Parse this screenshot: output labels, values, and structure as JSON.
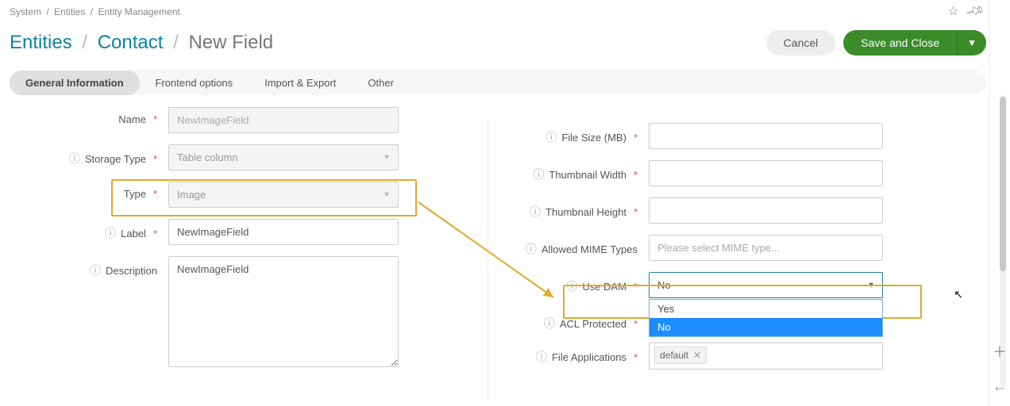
{
  "breadcrumbs": {
    "a": "System",
    "b": "Entities",
    "c": "Entity Management"
  },
  "title": {
    "a": "Entities",
    "b": "Contact",
    "c": "New Field"
  },
  "actions": {
    "cancel": "Cancel",
    "save": "Save and Close"
  },
  "tabs": {
    "general": "General Information",
    "frontend": "Frontend options",
    "import": "Import & Export",
    "other": "Other"
  },
  "left_form": {
    "name_label": "Name",
    "name_value": "NewImageField",
    "storage_label": "Storage Type",
    "storage_value": "Table column",
    "type_label": "Type",
    "type_value": "Image",
    "label_label": "Label",
    "label_value": "NewImageField",
    "desc_label": "Description",
    "desc_value": "NewImageField"
  },
  "right_form": {
    "filesize_label": "File Size (MB)",
    "filesize_value": "",
    "thumbw_label": "Thumbnail Width",
    "thumbw_value": "",
    "thumbh_label": "Thumbnail Height",
    "thumbh_value": "",
    "mime_label": "Allowed MIME Types",
    "mime_placeholder": "Please select MIME type...",
    "usedam_label": "Use DAM",
    "usedam_value": "No",
    "usedam_opts": {
      "yes": "Yes",
      "no": "No"
    },
    "acl_label": "ACL Protected",
    "fileapp_label": "File Applications",
    "fileapp_tag": "default"
  }
}
